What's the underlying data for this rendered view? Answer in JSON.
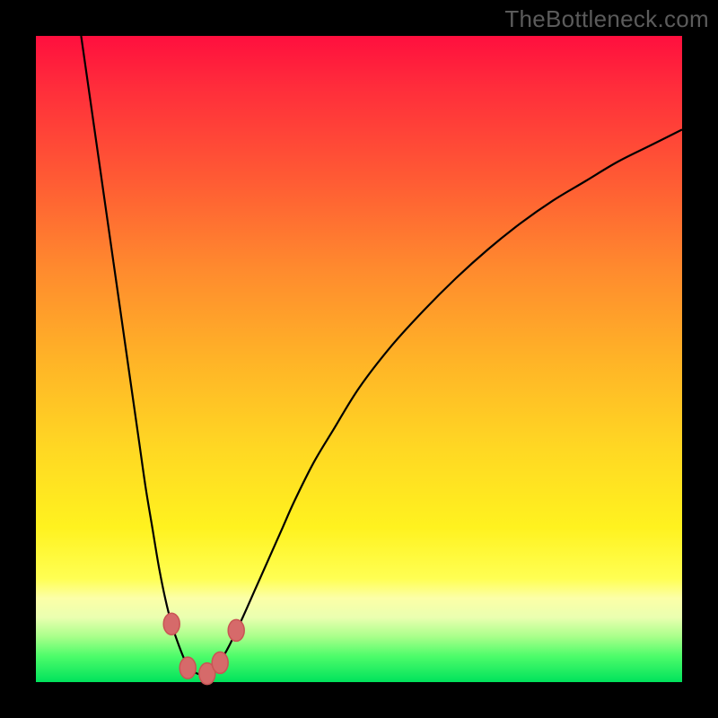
{
  "watermark": "TheBottleneck.com",
  "colors": {
    "frame": "#000000",
    "curve": "#000000",
    "marker_fill": "#d66a6a",
    "marker_stroke": "#c95454"
  },
  "chart_data": {
    "type": "line",
    "title": "",
    "xlabel": "",
    "ylabel": "",
    "xlim": [
      0,
      100
    ],
    "ylim": [
      0,
      100
    ],
    "series": [
      {
        "name": "bottleneck-curve",
        "x": [
          7,
          8,
          9,
          10,
          11,
          12,
          13,
          14,
          15,
          16,
          17,
          18,
          19,
          20,
          21,
          22,
          23,
          24,
          25,
          26,
          27,
          28,
          29,
          30,
          32,
          34,
          36,
          38,
          40,
          43,
          46,
          50,
          55,
          60,
          65,
          70,
          75,
          80,
          85,
          90,
          95,
          100
        ],
        "y": [
          100,
          93,
          86,
          79,
          72,
          65,
          58,
          51,
          44,
          37,
          30,
          24,
          18,
          13,
          9,
          6,
          3.5,
          2,
          1.3,
          1.2,
          1.6,
          2.6,
          4,
          5.8,
          10,
          14.5,
          19,
          23.5,
          28,
          34,
          39,
          45.5,
          52,
          57.5,
          62.5,
          67,
          71,
          74.5,
          77.5,
          80.5,
          83,
          85.5
        ]
      }
    ],
    "markers": [
      {
        "x": 21.0,
        "y": 9.0
      },
      {
        "x": 23.5,
        "y": 2.2
      },
      {
        "x": 26.5,
        "y": 1.3
      },
      {
        "x": 28.5,
        "y": 3.0
      },
      {
        "x": 31.0,
        "y": 8.0
      }
    ],
    "gradient_zones": [
      {
        "label": "high-bottleneck",
        "color": "#ff0f3e",
        "position": 0.0
      },
      {
        "label": "medium-bottleneck",
        "color": "#ffd823",
        "position": 0.6
      },
      {
        "label": "low-bottleneck",
        "color": "#00e25c",
        "position": 1.0
      }
    ]
  }
}
